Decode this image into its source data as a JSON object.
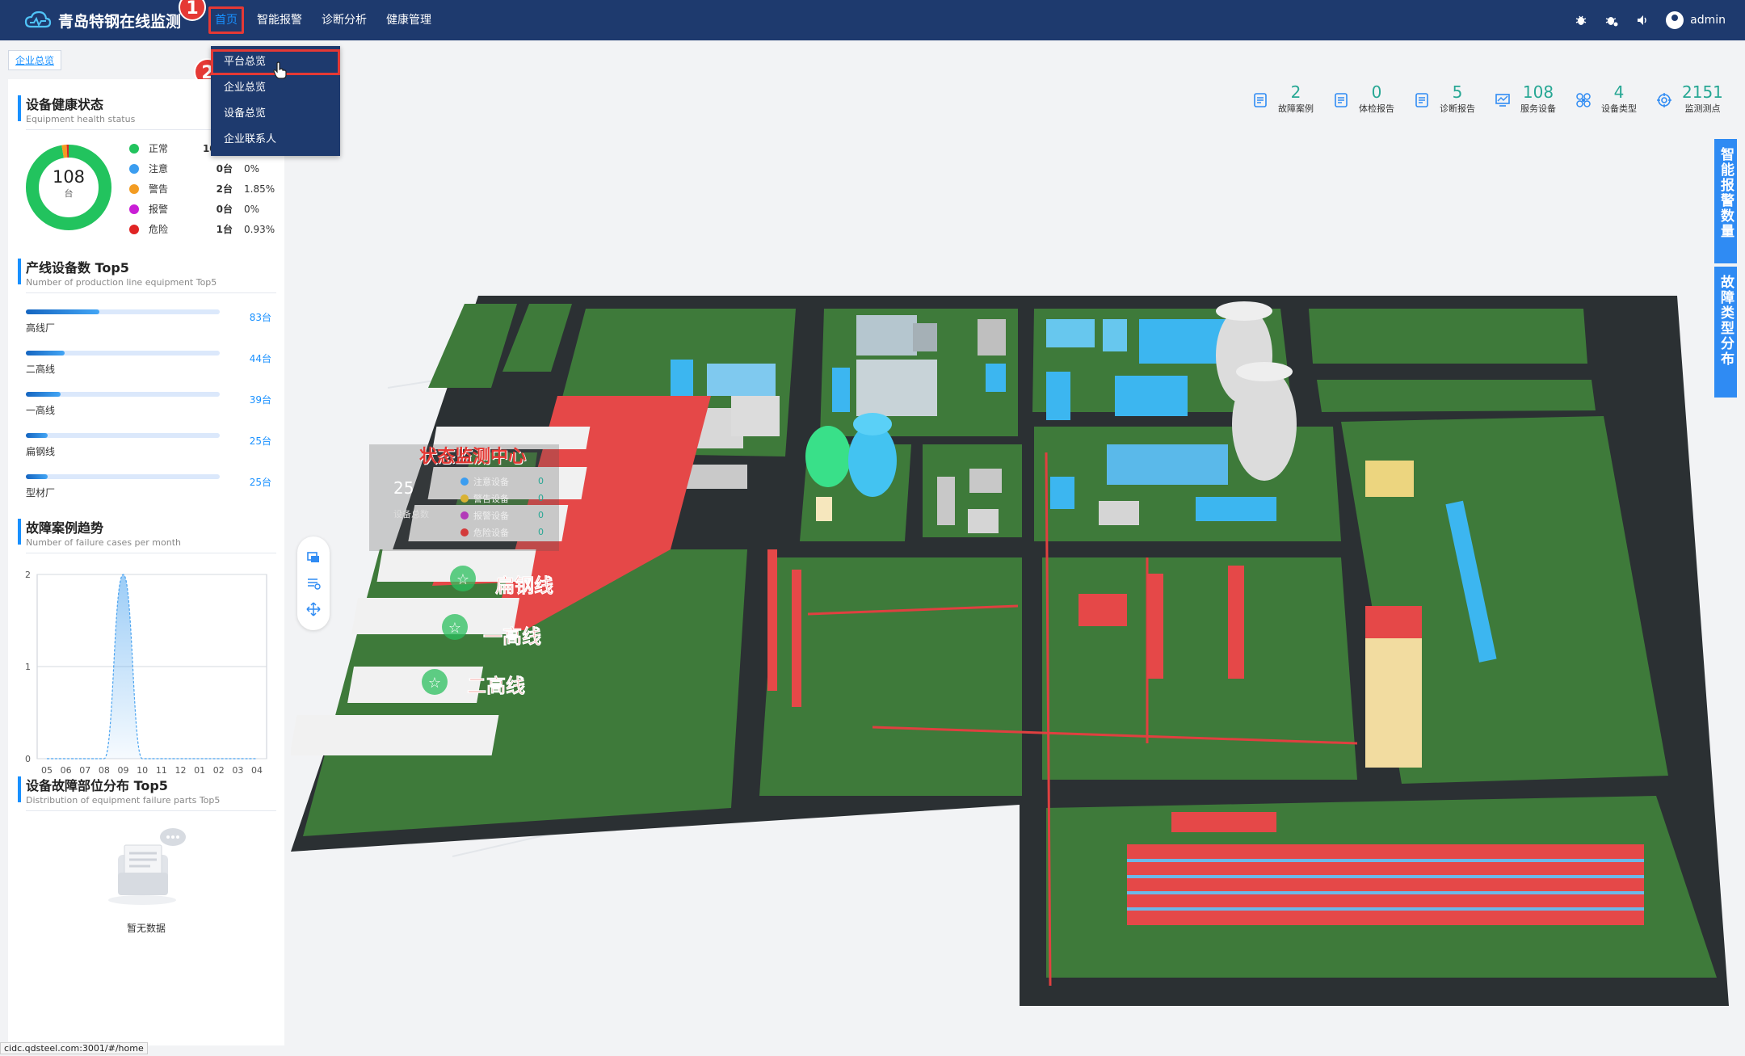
{
  "app": {
    "title": "青岛特钢在线监测"
  },
  "nav": [
    {
      "label": "首页",
      "active": true
    },
    {
      "label": "智能报警"
    },
    {
      "label": "诊断分析"
    },
    {
      "label": "健康管理"
    }
  ],
  "topbar_right": {
    "user": "admin"
  },
  "callouts": [
    "1",
    "2"
  ],
  "dropdown": [
    "平台总览",
    "企业总览",
    "设备总览",
    "企业联系人"
  ],
  "breadcrumb": "企业总览",
  "health": {
    "title": "设备健康状态",
    "subtitle": "Equipment health status",
    "total": "108",
    "unit": "台",
    "items": [
      {
        "name": "正常",
        "count": "105台",
        "pct": "",
        "color": "#22c35e",
        "value": 105
      },
      {
        "name": "注意",
        "count": "0台",
        "pct": "0%",
        "color": "#3b9df0",
        "value": 0
      },
      {
        "name": "警告",
        "count": "2台",
        "pct": "1.85%",
        "color": "#f39c22",
        "value": 2
      },
      {
        "name": "报警",
        "count": "0台",
        "pct": "0%",
        "color": "#c91ed6",
        "value": 0
      },
      {
        "name": "危险",
        "count": "1台",
        "pct": "0.93%",
        "color": "#e02424",
        "value": 1
      }
    ]
  },
  "top5": {
    "title": "产线设备数 Top5",
    "subtitle": "Number of production line equipment Top5",
    "max": 220,
    "items": [
      {
        "name": "高线厂",
        "value": 83,
        "label": "83台"
      },
      {
        "name": "二高线",
        "value": 44,
        "label": "44台"
      },
      {
        "name": "一高线",
        "value": 39,
        "label": "39台"
      },
      {
        "name": "扁钢线",
        "value": 25,
        "label": "25台"
      },
      {
        "name": "型材厂",
        "value": 25,
        "label": "25台"
      }
    ]
  },
  "trend": {
    "title": "故障案例趋势",
    "subtitle": "Number of failure cases per month"
  },
  "chart_data": {
    "type": "area",
    "title": "故障案例趋势",
    "x": [
      "05",
      "06",
      "07",
      "08",
      "09",
      "10",
      "11",
      "12",
      "01",
      "02",
      "03",
      "04"
    ],
    "y": [
      0,
      0,
      0,
      0,
      2,
      0,
      0,
      0,
      0,
      0,
      0,
      0
    ],
    "ylim": [
      0,
      2
    ],
    "yticks": [
      "0",
      "1",
      "2"
    ],
    "grid": true,
    "color": "#4aa3f0"
  },
  "parts": {
    "title": "设备故障部位分布 Top5",
    "subtitle": "Distribution of equipment failure parts Top5",
    "empty": "暂无数据"
  },
  "stats": [
    {
      "value": "2",
      "label": "故障案例",
      "icon": "document-icon"
    },
    {
      "value": "0",
      "label": "体检报告",
      "icon": "document-icon"
    },
    {
      "value": "5",
      "label": "诊断报告",
      "icon": "document-icon"
    },
    {
      "value": "108",
      "label": "服务设备",
      "icon": "monitor-icon"
    },
    {
      "value": "4",
      "label": "设备类型",
      "icon": "fan-icon"
    },
    {
      "value": "2151",
      "label": "监测测点",
      "icon": "target-icon"
    }
  ],
  "vtabs": [
    "智能报警数量",
    "故障类型分布"
  ],
  "overlay": {
    "title": "状态监测中心",
    "total": "25",
    "total_label": "设备总数",
    "rows": [
      {
        "name": "注意设备",
        "count": "0",
        "color": "#3b9df0"
      },
      {
        "name": "警告设备",
        "count": "0",
        "color": "#d9b233"
      },
      {
        "name": "报警设备",
        "count": "0",
        "color": "#b23bb8"
      },
      {
        "name": "危险设备",
        "count": "0",
        "color": "#d33b3b"
      }
    ]
  },
  "map_labels": [
    "扁钢线",
    "一高线",
    "二高线"
  ],
  "status_url": "cidc.qdsteel.com:3001/#/home"
}
